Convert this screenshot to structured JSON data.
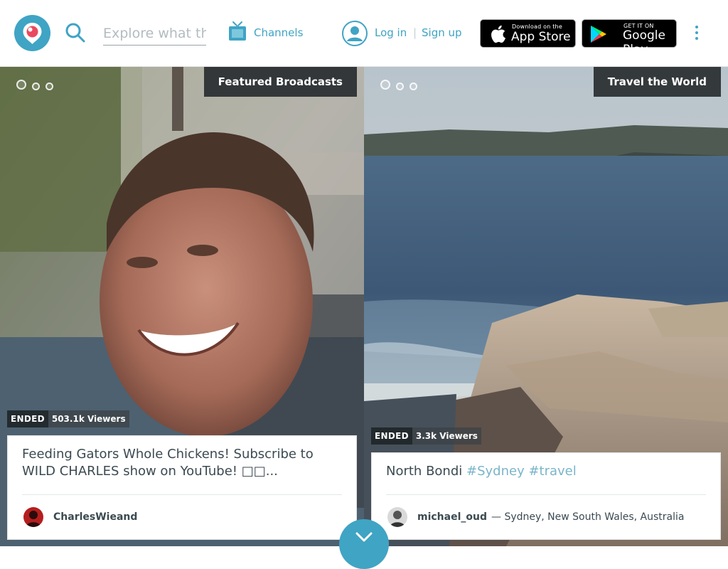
{
  "header": {
    "search_placeholder": "Explore what the",
    "channels_label": "Channels",
    "login_label": "Log in",
    "separator": "|",
    "signup_label": "Sign up",
    "appstore": {
      "small": "Download on the",
      "big": "App Store"
    },
    "googleplay": {
      "small": "GET IT ON",
      "big": "Google Play"
    }
  },
  "broadcasts": [
    {
      "feature_label": "Featured Broadcasts",
      "status": "ENDED",
      "viewers": "503.1k Viewers",
      "title": "Feeding Gators Whole Chickens! Subscribe to WILD CHARLES show on YouTube! □□...",
      "username": "CharlesWieand",
      "location": ""
    },
    {
      "feature_label": "Travel the World",
      "status": "ENDED",
      "viewers": "3.3k Viewers",
      "title": "North Bondi",
      "hashtags": "#Sydney #travel",
      "username": "michael_oud",
      "location": "— Sydney, New South Wales, Australia"
    }
  ],
  "colors": {
    "brand": "#40a4c4",
    "text": "#3b4a51",
    "hashtag": "#7ab5c9"
  }
}
